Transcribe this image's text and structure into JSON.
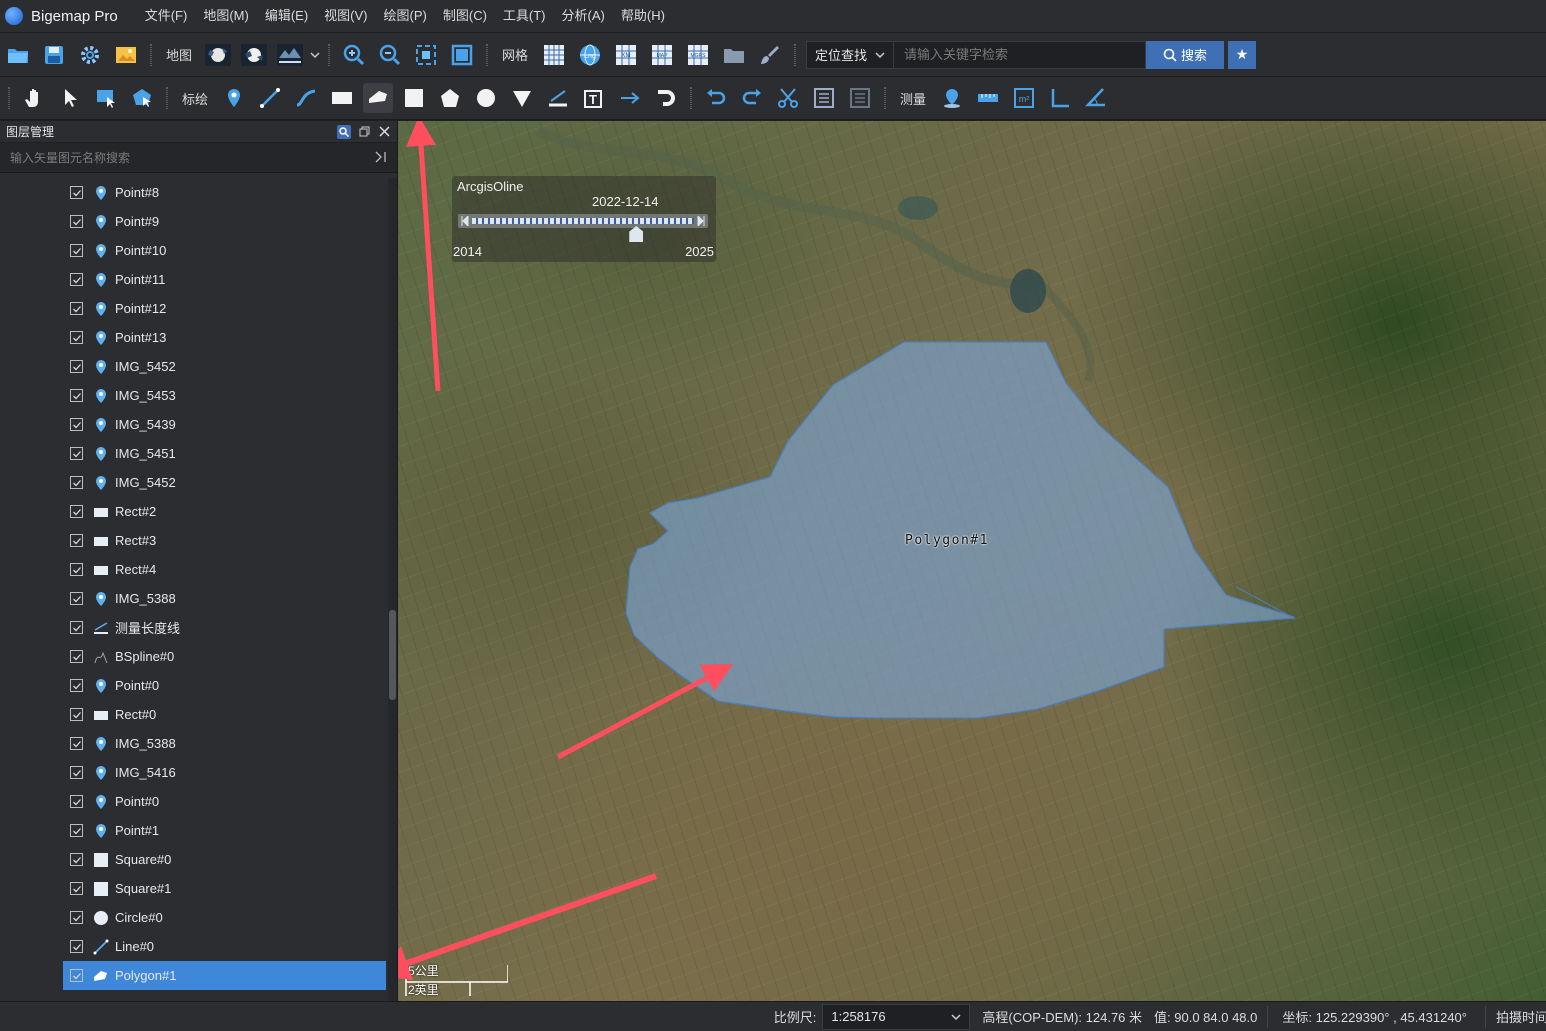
{
  "app": {
    "title": "Bigemap Pro"
  },
  "menu": [
    "文件(F)",
    "地图(M)",
    "编辑(E)",
    "视图(V)",
    "绘图(P)",
    "制图(C)",
    "工具(T)",
    "分析(A)",
    "帮助(H)"
  ],
  "toolbar1": {
    "map_label": "地图",
    "grid_label": "网格",
    "locate_select": "定位查找",
    "search_placeholder": "请输入关键字检索",
    "search_button": "搜索"
  },
  "toolbar2": {
    "annotate_label": "标绘",
    "measure_label": "测量"
  },
  "layer_panel": {
    "title": "图层管理",
    "search_placeholder": "输入矢量图元名称搜索",
    "items": [
      {
        "label": "Point#8",
        "icon": "point-marker-icon"
      },
      {
        "label": "Point#9",
        "icon": "point-marker-icon"
      },
      {
        "label": "Point#10",
        "icon": "point-marker-icon"
      },
      {
        "label": "Point#11",
        "icon": "point-marker-icon"
      },
      {
        "label": "Point#12",
        "icon": "point-marker-icon"
      },
      {
        "label": "Point#13",
        "icon": "point-marker-icon"
      },
      {
        "label": "IMG_5452",
        "icon": "point-marker-icon"
      },
      {
        "label": "IMG_5453",
        "icon": "point-marker-icon"
      },
      {
        "label": "IMG_5439",
        "icon": "point-marker-icon"
      },
      {
        "label": "IMG_5451",
        "icon": "point-marker-icon"
      },
      {
        "label": "IMG_5452",
        "icon": "point-marker-icon"
      },
      {
        "label": "Rect#2",
        "icon": "rect-icon"
      },
      {
        "label": "Rect#3",
        "icon": "rect-icon"
      },
      {
        "label": "Rect#4",
        "icon": "rect-icon"
      },
      {
        "label": "IMG_5388",
        "icon": "point-marker-icon"
      },
      {
        "label": "测量长度线",
        "icon": "measure-line-icon"
      },
      {
        "label": "BSpline#0",
        "icon": "bspline-icon"
      },
      {
        "label": "Point#0",
        "icon": "point-marker-icon"
      },
      {
        "label": "Rect#0",
        "icon": "rect-icon"
      },
      {
        "label": "IMG_5388",
        "icon": "point-marker-icon"
      },
      {
        "label": "IMG_5416",
        "icon": "point-marker-icon"
      },
      {
        "label": "Point#0",
        "icon": "point-marker-icon"
      },
      {
        "label": "Point#1",
        "icon": "point-marker-icon"
      },
      {
        "label": "Square#0",
        "icon": "square-icon"
      },
      {
        "label": "Square#1",
        "icon": "square-icon"
      },
      {
        "label": "Circle#0",
        "icon": "circle-icon"
      },
      {
        "label": "Line#0",
        "icon": "line-icon"
      },
      {
        "label": "Polygon#1",
        "icon": "polygon-icon",
        "selected": true
      }
    ]
  },
  "map": {
    "timeline": {
      "source": "ArcgisOline",
      "date": "2022-12-14",
      "min": "2014",
      "max": "2025",
      "position_fraction": 0.74
    },
    "polygon_label": "Polygon#1",
    "scale_km": "5公里",
    "scale_mi": "2英里"
  },
  "status": {
    "scale_label": "比例尺:",
    "scale_value": "1:258176",
    "elevation": "高程(COP-DEM):  124.76 米",
    "value": "值:  90.0 84.0 48.0",
    "coords": "坐标:  125.229390° , 45.431240°",
    "capture_time": "拍摄时间"
  },
  "colors": {
    "accent": "#3f87d8",
    "button": "#3f6fb5",
    "arrow": "#ff4f5e",
    "polygon_fill": "#7aa6d8"
  }
}
